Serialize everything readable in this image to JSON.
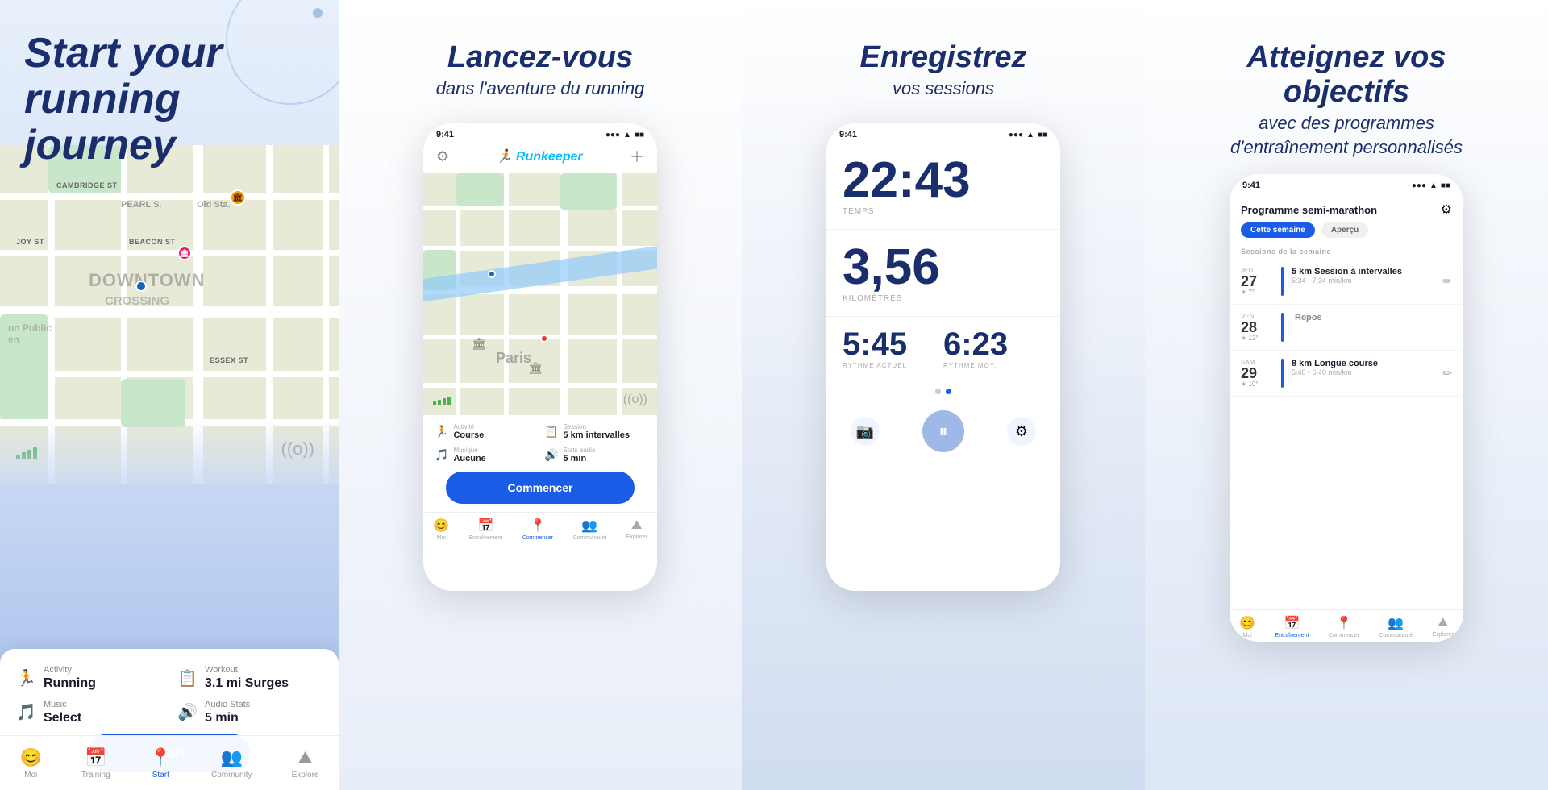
{
  "panel1": {
    "headline_line1": "Start your",
    "headline_line2": "running journey",
    "activity_label": "Activity",
    "activity_value": "Running",
    "workout_label": "Workout",
    "workout_value": "3.1 mi Surges",
    "music_label": "Music",
    "music_value": "Select",
    "audiostats_label": "Audio Stats",
    "audiostats_value": "5 min",
    "start_btn": "Start",
    "nav_items": [
      "Moi",
      "Training",
      "Start",
      "Community",
      "Explore"
    ]
  },
  "panel2": {
    "headline_main": "Lancez-vous",
    "headline_sub": "dans l'aventure du running",
    "status_time": "9:41",
    "app_name": "Runkeeper",
    "activity_label": "Activité",
    "activity_value": "Course",
    "session_label": "Session",
    "session_value": "5 km intervalles",
    "music_label": "Musique",
    "music_value": "Aucune",
    "audiostats_label": "Stats audio",
    "audiostats_value": "5 min",
    "start_btn": "Commencer",
    "nav_items": [
      "Moi",
      "Entraînement",
      "Commencer",
      "Communauté",
      "Explorer"
    ]
  },
  "panel3": {
    "headline_main": "Enregistrez",
    "headline_sub": "vos sessions",
    "status_time": "9:41",
    "time_value": "22:43",
    "time_label": "TEMPS",
    "dist_value": "3,56",
    "dist_label": "KILOMÈTRES",
    "pace_current": "5:45",
    "pace_current_label": "RYTHME ACTUEL",
    "pace_avg": "6:23",
    "pace_avg_label": "RYTHME MOY."
  },
  "panel4": {
    "headline_main": "Atteignez vos objectifs",
    "headline_sub1": "avec des programmes",
    "headline_sub2": "d'entraînement personnalisés",
    "status_time": "9:41",
    "program_title": "Programme semi-marathon",
    "tab_week": "Cette semaine",
    "tab_preview": "Aperçu",
    "section_label": "Sessions de la semaine",
    "sessions": [
      {
        "day": "JEU.",
        "date": "27",
        "weather": "☀ 7°",
        "title": "5 km Session à intervalles",
        "pace": "5:34 - 7:34 min/km",
        "is_rest": false
      },
      {
        "day": "VEN.",
        "date": "28",
        "weather": "☀ 12°",
        "title": "Repos",
        "pace": "",
        "is_rest": true
      },
      {
        "day": "SAM.",
        "date": "29",
        "weather": "☀ 10°",
        "title": "8 km Longue course",
        "pace": "5:40 - 6:40 min/km",
        "is_rest": false
      }
    ],
    "nav_items": [
      "Moi",
      "Entraînement",
      "Commencer",
      "Communauté",
      "Explorer"
    ]
  },
  "colors": {
    "brand_blue": "#1a5ce5",
    "dark_navy": "#1a2e6e",
    "light_bg": "#e8f0fb"
  },
  "icons": {
    "running": "🏃",
    "music": "🎵",
    "workout": "📋",
    "audio": "🔊",
    "gear": "⚙",
    "home": "😊",
    "calendar": "📅",
    "location": "📍",
    "people": "👥",
    "mountain": "⛰",
    "camera": "📷",
    "pause": "⏸",
    "pencil": "✏"
  }
}
